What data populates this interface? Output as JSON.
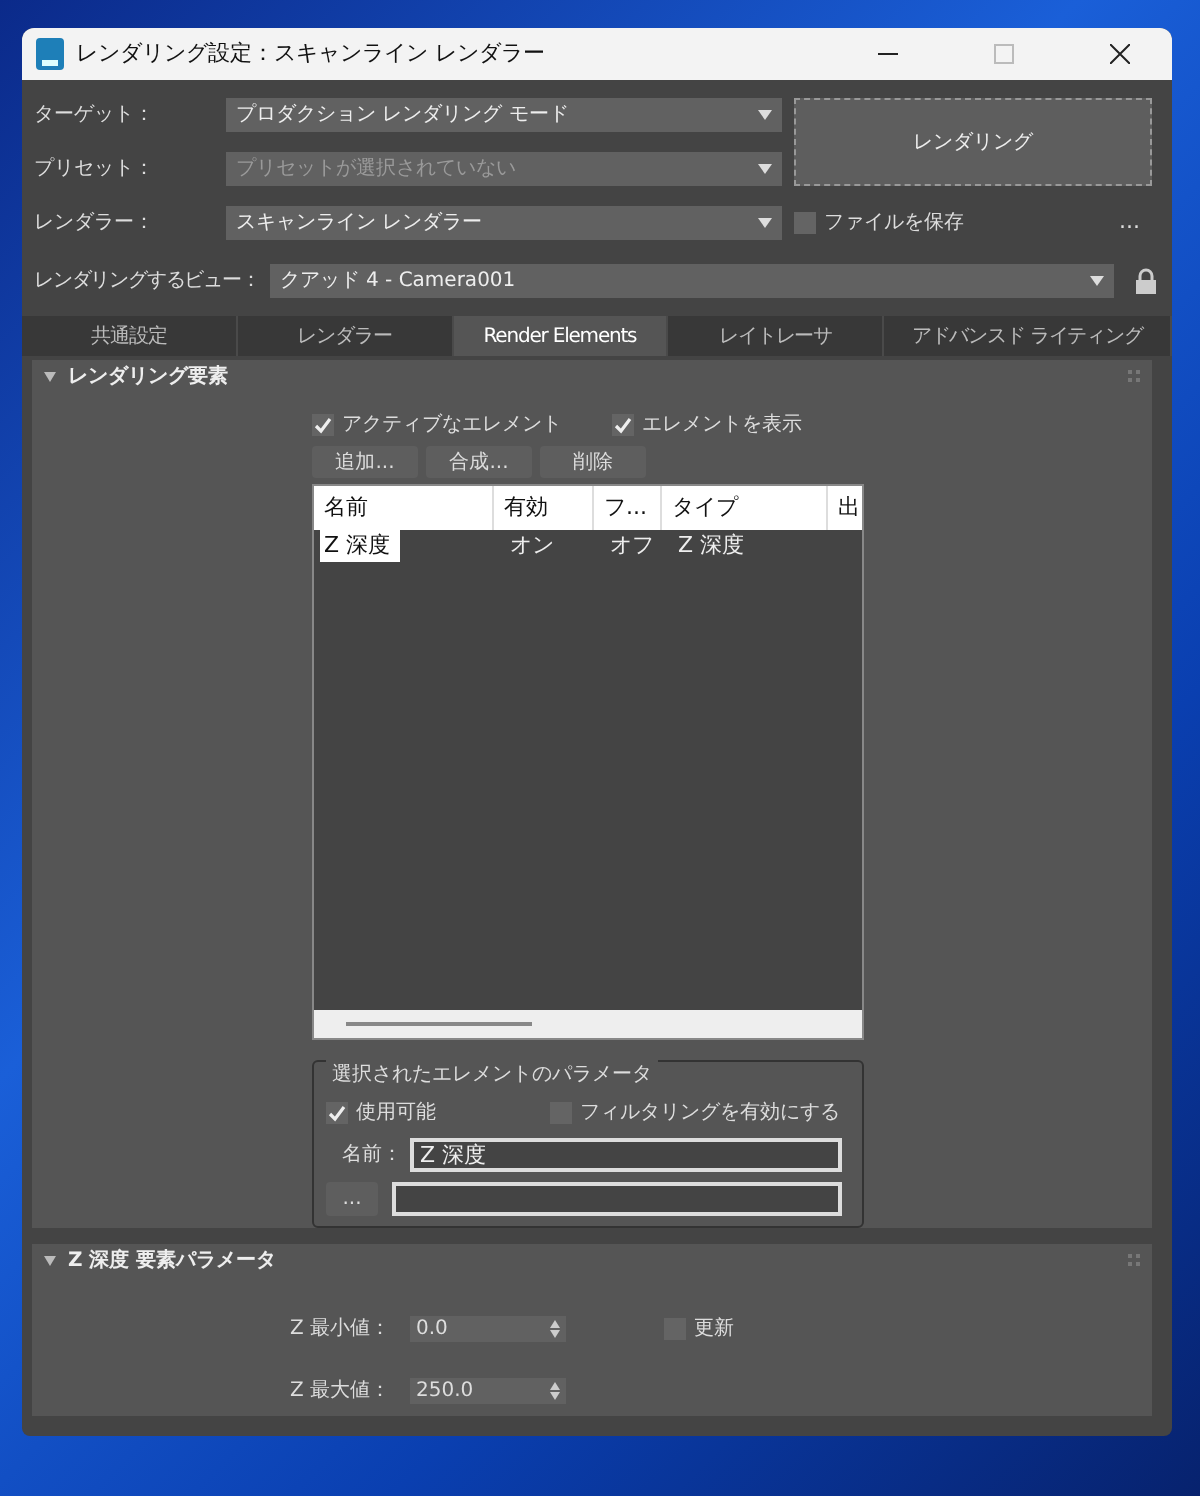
{
  "window": {
    "title": "レンダリング設定：スキャンライン レンダラー"
  },
  "form": {
    "target": {
      "label": "ターゲット：",
      "value": "プロダクション レンダリング モード",
      "disabled": false
    },
    "preset": {
      "label": "プリセット：",
      "value": "プリセットが選択されていない",
      "disabled": true
    },
    "renderer": {
      "label": "レンダラー：",
      "value": "スキャンライン レンダラー",
      "disabled": false
    },
    "view": {
      "label": "レンダリングするビュー：",
      "value": "クアッド 4 - Camera001",
      "disabled": false
    },
    "render_button": "レンダリング",
    "save_file": {
      "label": "ファイルを保存",
      "checked": false
    },
    "more_button": "..."
  },
  "tabs": [
    {
      "label": "共通設定",
      "selected": false
    },
    {
      "label": "レンダラー",
      "selected": false
    },
    {
      "label": "Render Elements",
      "selected": true
    },
    {
      "label": "レイトレーサ",
      "selected": false
    },
    {
      "label": "アドバンスド ライティング",
      "selected": false
    }
  ],
  "elements_rollout": {
    "title": "レンダリング要素",
    "expanded": true,
    "active_elements": {
      "label": "アクティブなエレメント",
      "checked": true
    },
    "show_elements": {
      "label": "エレメントを表示",
      "checked": true
    },
    "buttons": [
      "追加...",
      "合成...",
      "削除"
    ],
    "table": {
      "columns": [
        "名前",
        "有効",
        "フ...",
        "タイプ",
        "出"
      ],
      "rows": [
        {
          "cells": [
            "Z 深度",
            "オン",
            "オフ",
            "Z 深度"
          ],
          "selected": true
        }
      ]
    },
    "params": {
      "title": "選択されたエレメントのパラメータ",
      "enabled": {
        "label": "使用可能",
        "checked": true
      },
      "filtering": {
        "label": "フィルタリングを有効にする",
        "checked": false
      },
      "name_label": "名前：",
      "name_value": "Z 深度",
      "browse_button": "..."
    }
  },
  "z_rollout": {
    "title": "Z 深度 要素パラメータ",
    "expanded": true,
    "min": {
      "label": "Z 最小値：",
      "value": "0.0"
    },
    "max": {
      "label": "Z 最大値：",
      "value": "250.0"
    },
    "update": {
      "label": "更新",
      "checked": false
    }
  }
}
